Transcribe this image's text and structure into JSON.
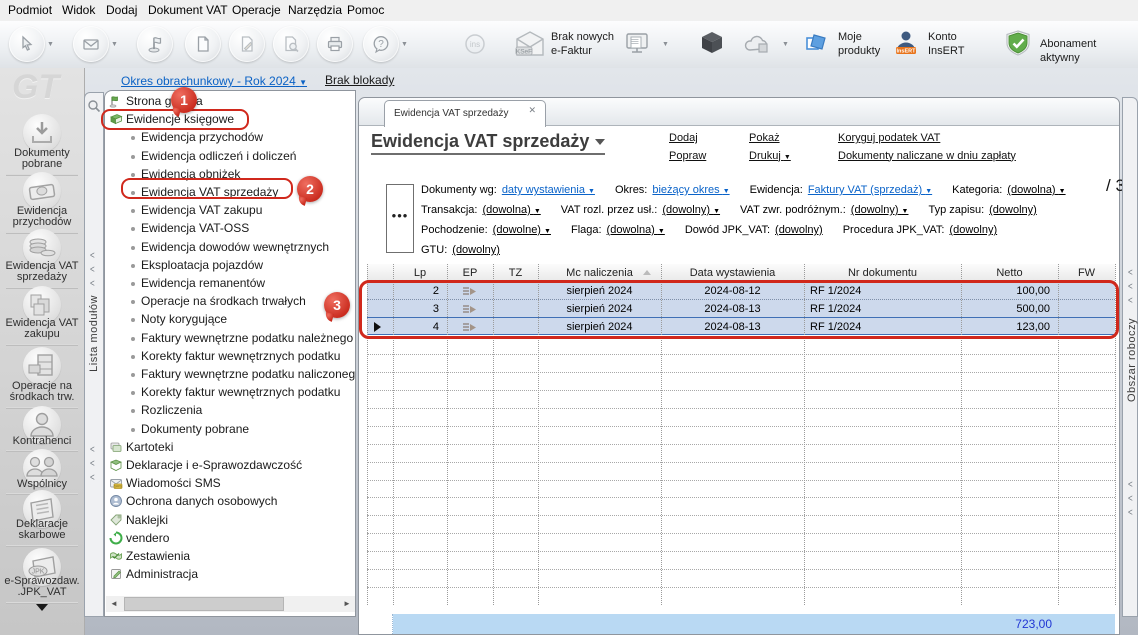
{
  "menu": {
    "items": [
      "Podmiot",
      "Widok",
      "Dodaj",
      "Dokument VAT",
      "Operacje",
      "Narzędzia",
      "Pomoc"
    ]
  },
  "toolbar": {
    "ksef_label": "Brak nowych\ne-Faktur",
    "moje_produkty_label": "Moje\nprodukty",
    "konto_label": "Konto\nInsERT",
    "abonament_label": "Abonament aktywny",
    "ins_badge": "ins",
    "ksef_badge": "KSeF",
    "insert_badge": "InsERT"
  },
  "sidebar": {
    "watermark": "GT",
    "items": [
      {
        "label": "Dokumenty\npobrane",
        "icon": "download"
      },
      {
        "label": "Ewidencja\nprzychodów",
        "icon": "money"
      },
      {
        "label": "Ewidencja VAT\nsprzedaży",
        "icon": "coins"
      },
      {
        "label": "Ewidencja VAT\nzakupu",
        "icon": "boxes"
      },
      {
        "label": "Operacje na\nśrodkach trw.",
        "icon": "cabinet"
      },
      {
        "label": "Kontrahenci",
        "icon": "person"
      },
      {
        "label": "Wspólnicy",
        "icon": "persons"
      },
      {
        "label": "Deklaracje\nskarbowe",
        "icon": "news"
      },
      {
        "label": "e-Sprawozdaw.\n.JPK_VAT",
        "icon": "jpk"
      }
    ]
  },
  "module_strip_label": "Lista modułów",
  "workspace_strip_label": "Obszar roboczy",
  "tree": {
    "period_link": "Okres obrachunkowy - Rok 2024",
    "lock_link": "Brak blokady",
    "items": [
      {
        "label": "Strona główna",
        "level": 0,
        "icon": "flag"
      },
      {
        "label": "Ewidencje księgowe",
        "level": 0,
        "icon": "book"
      },
      {
        "label": "Ewidencja przychodów",
        "level": 1
      },
      {
        "label": "Ewidencja odliczeń i doliczeń",
        "level": 1
      },
      {
        "label": "Ewidencja obniżek",
        "level": 1
      },
      {
        "label": "Ewidencja VAT sprzedaży",
        "level": 1
      },
      {
        "label": "Ewidencja VAT zakupu",
        "level": 1
      },
      {
        "label": "Ewidencja VAT-OSS",
        "level": 1
      },
      {
        "label": "Ewidencja dowodów wewnętrznych",
        "level": 1
      },
      {
        "label": "Eksploatacja pojazdów",
        "level": 1
      },
      {
        "label": "Ewidencja remanentów",
        "level": 1
      },
      {
        "label": "Operacje na środkach trwałych",
        "level": 1
      },
      {
        "label": "Noty korygujące",
        "level": 1
      },
      {
        "label": "Faktury wewnętrzne podatku należnego",
        "level": 1
      },
      {
        "label": "Korekty faktur wewnętrznych podatku",
        "level": 1
      },
      {
        "label": "Faktury wewnętrzne podatku naliczonego",
        "level": 1
      },
      {
        "label": "Korekty faktur wewnętrznych podatku",
        "level": 1
      },
      {
        "label": "Rozliczenia",
        "level": 1
      },
      {
        "label": "Dokumenty pobrane",
        "level": 1
      },
      {
        "label": "Kartoteki",
        "level": 0,
        "icon": "cards"
      },
      {
        "label": "Deklaracje i e-Sprawozdawczość",
        "level": 0,
        "icon": "decl"
      },
      {
        "label": "Wiadomości SMS",
        "level": 0,
        "icon": "sms"
      },
      {
        "label": "Ochrona danych osobowych",
        "level": 0,
        "icon": "shield"
      },
      {
        "label": "Naklejki",
        "level": 0,
        "icon": "tag"
      },
      {
        "label": "vendero",
        "level": 0,
        "icon": "vendero"
      },
      {
        "label": "Zestawienia",
        "level": 0,
        "icon": "report"
      },
      {
        "label": "Administracja",
        "level": 0,
        "icon": "admin"
      }
    ]
  },
  "main": {
    "tab": "Ewidencja VAT sprzedaży",
    "title": "Ewidencja VAT sprzedaży",
    "actions_col1": [
      "Dodaj",
      "Popraw"
    ],
    "actions_col2": [
      "Pokaż",
      "Drukuj"
    ],
    "actions_col3": [
      "Koryguj podatek VAT",
      "Dokumenty naliczane w dniu zapłaty"
    ],
    "record_count": "/ 3",
    "more_button": "•••",
    "filter_rows": [
      [
        {
          "label": "Dokumenty wg:",
          "value": "daty wystawienia",
          "arrow": true,
          "blue": true
        },
        {
          "label": "Okres:",
          "value": "bieżący okres",
          "arrow": true,
          "blue": true
        },
        {
          "label": "Ewidencja:",
          "value": "Faktury VAT (sprzedaż)",
          "arrow": true,
          "blue": true
        },
        {
          "label": "Kategoria:",
          "value": "(dowolna)",
          "arrow": true,
          "blue": false
        }
      ],
      [
        {
          "label": "Transakcja:",
          "value": "(dowolna)",
          "arrow": true,
          "blue": false
        },
        {
          "label": "VAT rozl. przez usł.:",
          "value": "(dowolny)",
          "arrow": true,
          "blue": false
        },
        {
          "label": "VAT zwr. podróżnym.:",
          "value": "(dowolny)",
          "arrow": true,
          "blue": false
        },
        {
          "label": "Typ zapisu:",
          "value": "(dowolny)",
          "arrow": false,
          "blue": false
        }
      ],
      [
        {
          "label": "Pochodzenie:",
          "value": "(dowolne)",
          "arrow": true,
          "blue": false
        },
        {
          "label": "Flaga:",
          "value": "(dowolna)",
          "arrow": true,
          "blue": false
        },
        {
          "label": "Dowód JPK_VAT:",
          "value": "(dowolny)",
          "arrow": false,
          "blue": false
        },
        {
          "label": "Procedura JPK_VAT:",
          "value": "(dowolny)",
          "arrow": false,
          "blue": false
        }
      ],
      [
        {
          "label": "GTU:",
          "value": "(dowolny)",
          "arrow": false,
          "blue": false
        }
      ]
    ]
  },
  "table": {
    "columns": [
      "",
      "Lp",
      "EP",
      "TZ",
      "Mc naliczenia",
      "Data wystawienia",
      "Nr dokumentu",
      "Netto",
      "FW"
    ],
    "rows": [
      {
        "lp": "2",
        "mc": "sierpień 2024",
        "data": "2024-08-12",
        "nr": "RF 1/2024",
        "netto": "100,00",
        "current": false
      },
      {
        "lp": "3",
        "mc": "sierpień 2024",
        "data": "2024-08-13",
        "nr": "RF 1/2024",
        "netto": "500,00",
        "current": false
      },
      {
        "lp": "4",
        "mc": "sierpień 2024",
        "data": "2024-08-13",
        "nr": "RF 1/2024",
        "netto": "123,00",
        "current": true
      }
    ],
    "summary_netto": "723,00"
  },
  "annotations": {
    "badge1": "1",
    "badge2": "2",
    "badge3": "3"
  },
  "colors": {
    "accent_blue": "#0a63c9",
    "selection": "#cdd9ec",
    "summary_bg": "#b9d9f3",
    "annotation_red": "#d0281c",
    "summary_text": "#2136d4"
  }
}
